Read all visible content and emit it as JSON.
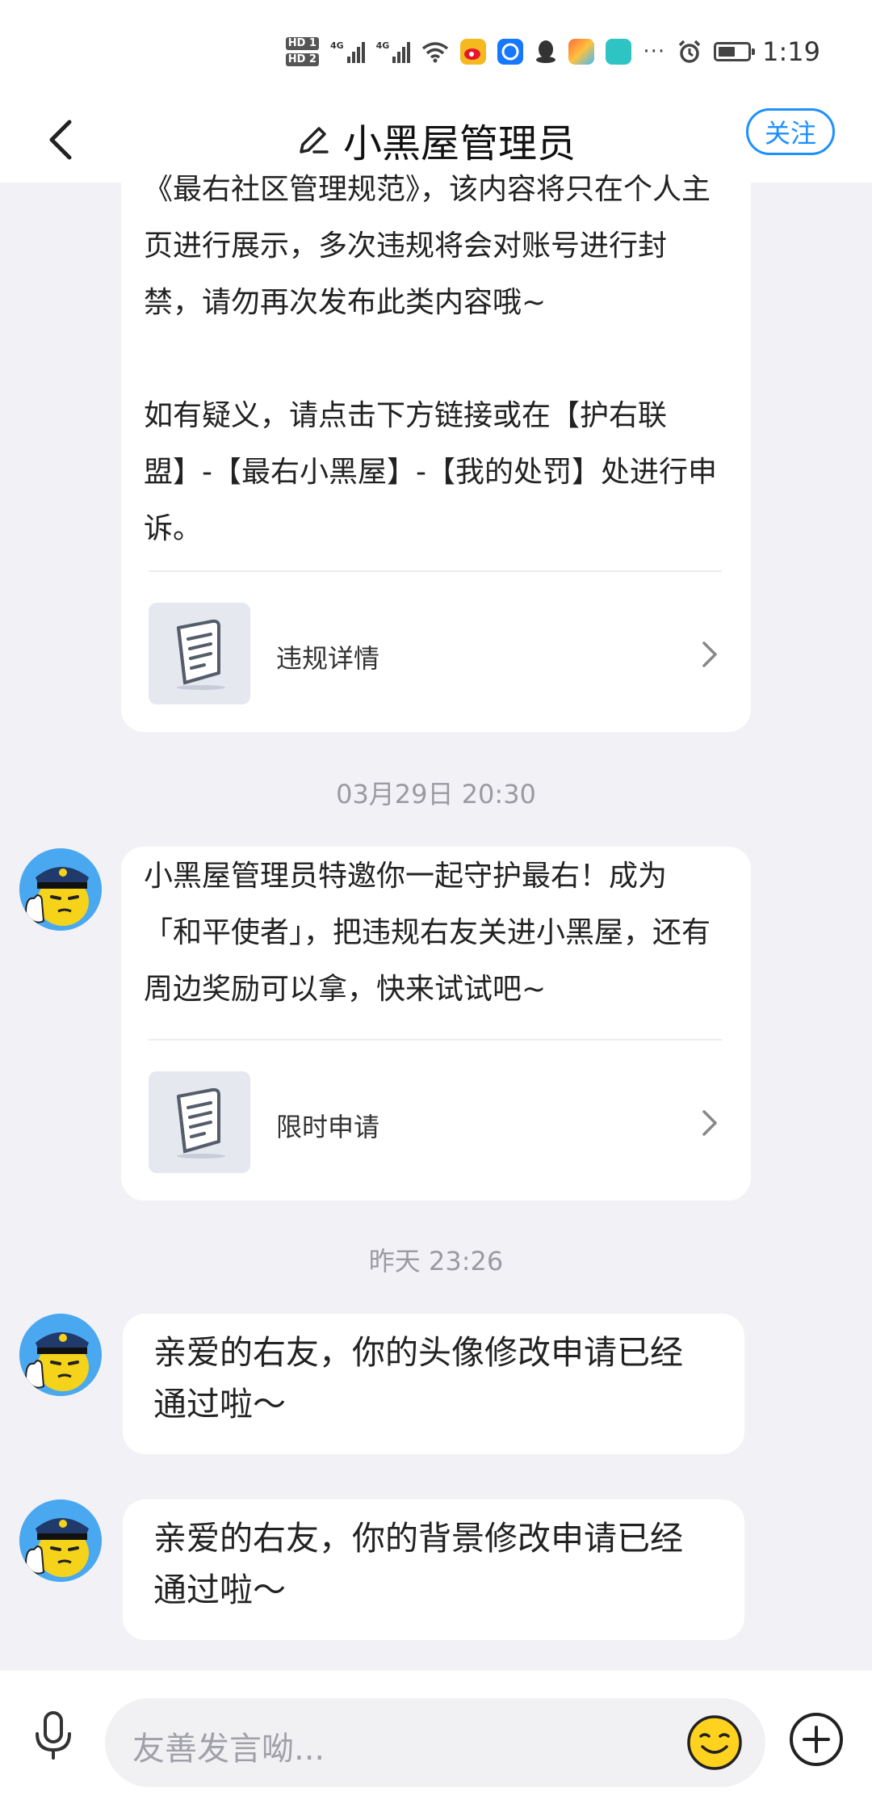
{
  "status_bar": {
    "hd1": "HD 1",
    "hd2": "HD 2",
    "net1": "4G",
    "net2": "4G",
    "dots": "···",
    "time": "1:19"
  },
  "header": {
    "title": "小黑屋管理员",
    "follow_label": "关注"
  },
  "messages": {
    "card1": {
      "text": "《最右社区管理规范》，该内容将只在个人主页进行展示，多次违规将会对账号进行封禁，请勿再次发布此类内容哦~\n\n如有疑义，请点击下方链接或在【护右联盟】-【最右小黑屋】-【我的处罚】处进行申诉。",
      "link_label": "违规详情"
    },
    "ts1": "03月29日 20:30",
    "card2": {
      "text": "小黑屋管理员特邀你一起守护最右！成为「和平使者」，把违规右友关进小黑屋，还有周边奖励可以拿，快来试试吧~",
      "link_label": "限时申请"
    },
    "ts2": "昨天 23:26",
    "msg3": "亲爱的右友，你的头像修改申请已经通过啦～",
    "msg4": "亲爱的右友，你的背景修改申请已经通过啦～"
  },
  "input": {
    "placeholder": "友善发言呦..."
  }
}
